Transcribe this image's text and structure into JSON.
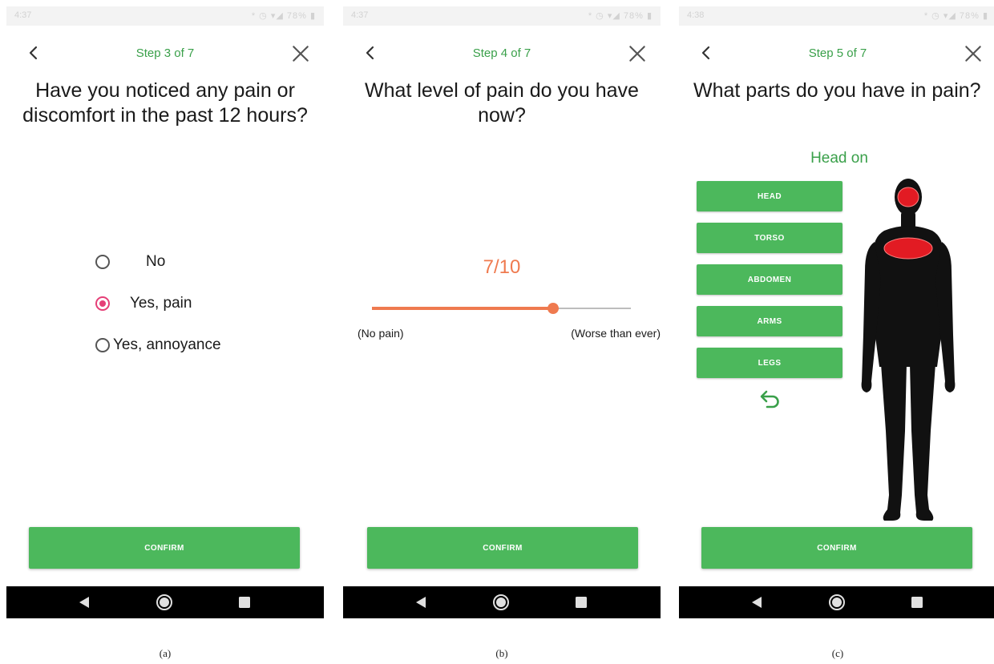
{
  "colors": {
    "accent_green": "#4cb85c",
    "step_green": "#3aa04a",
    "radio_selected": "#e53f77",
    "slider_orange": "#ef7a4f",
    "highlight_red": "#e21b23"
  },
  "screens": [
    {
      "statusbar": {
        "time": "4:37",
        "icons": "* ◷ ▾◢ 78% ▮"
      },
      "step": "Step 3 of 7",
      "question": "Have you noticed any pain or discomfort in the past 12 hours?",
      "options": [
        {
          "label": "No",
          "selected": false
        },
        {
          "label": "Yes, pain",
          "selected": true
        },
        {
          "label": "Yes, annoyance",
          "selected": false
        }
      ],
      "confirm_label": "CONFIRM",
      "caption": "(a)"
    },
    {
      "statusbar": {
        "time": "4:37",
        "icons": "* ◷ ▾◢ 78% ▮"
      },
      "step": "Step 4 of 7",
      "question": "What level of pain do you have now?",
      "pain": {
        "value": 7,
        "max": 10,
        "display": "7/10",
        "min_label": "(No pain)",
        "max_label": "(Worse than ever)"
      },
      "confirm_label": "CONFIRM",
      "caption": "(b)"
    },
    {
      "statusbar": {
        "time": "4:38",
        "icons": "* ◷ ▾◢ 78% ▮"
      },
      "step": "Step 5 of 7",
      "question": "What parts do you have in pain?",
      "body_status": "Head on",
      "parts": [
        "HEAD",
        "TORSO",
        "ABDOMEN",
        "ARMS",
        "LEGS"
      ],
      "selected_parts": [
        "HEAD",
        "TORSO"
      ],
      "confirm_label": "CONFIRM",
      "caption": "(c)"
    }
  ]
}
